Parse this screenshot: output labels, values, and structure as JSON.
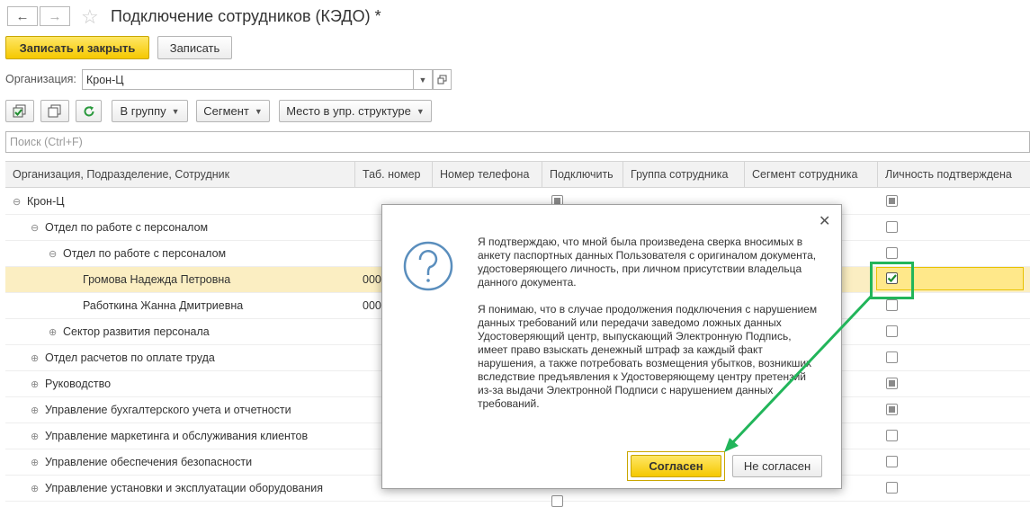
{
  "header": {
    "back_icon": "arrow-left-icon",
    "forward_icon": "arrow-right-icon",
    "favorite_icon": "star-icon",
    "title": "Подключение сотрудников (КЭДО) *"
  },
  "toolbar": {
    "save_close_label": "Записать и закрыть",
    "save_label": "Записать"
  },
  "organization": {
    "label": "Организация:",
    "value": "Крон-Ц"
  },
  "actions": {
    "group_label": "В группу",
    "segment_label": "Сегмент",
    "place_label": "Место в упр. структуре"
  },
  "search": {
    "placeholder": "Поиск (Ctrl+F)"
  },
  "table": {
    "columns": [
      "Организация, Подразделение, Сотрудник",
      "Таб. номер",
      "Номер телефона",
      "Подключить",
      "Группа сотрудника",
      "Сегмент сотрудника",
      "Личность подтверждена"
    ],
    "rows": [
      {
        "name": "Крон-Ц",
        "tab": "",
        "connect": "gray",
        "confirmed": "gray"
      },
      {
        "name": "Отдел по работе с персоналом",
        "tab": "",
        "connect": "",
        "confirmed": "empty"
      },
      {
        "name": "Отдел по работе с персоналом",
        "tab": "",
        "connect": "",
        "confirmed": "empty"
      },
      {
        "name": "Громова Надежда Петровна",
        "tab": "000",
        "connect": "",
        "confirmed": "checked"
      },
      {
        "name": "Работкина Жанна Дмитриевна",
        "tab": "000",
        "connect": "",
        "confirmed": "empty"
      },
      {
        "name": "Сектор развития персонала",
        "tab": "",
        "connect": "",
        "confirmed": "empty"
      },
      {
        "name": "Отдел расчетов по оплате труда",
        "tab": "",
        "connect": "",
        "confirmed": "empty"
      },
      {
        "name": "Руководство",
        "tab": "",
        "connect": "",
        "confirmed": "gray"
      },
      {
        "name": "Управление бухгалтерского учета и отчетности",
        "tab": "",
        "connect": "",
        "confirmed": "gray"
      },
      {
        "name": "Управление маркетинга и обслуживания клиентов",
        "tab": "",
        "connect": "",
        "confirmed": "empty"
      },
      {
        "name": "Управление обеспечения безопасности",
        "tab": "",
        "connect": "",
        "confirmed": "empty"
      },
      {
        "name": "Управление установки и эксплуатации оборудования",
        "tab": "",
        "connect": "empty",
        "confirmed": "empty"
      }
    ]
  },
  "dialog": {
    "paragraph1": "Я подтверждаю, что мной была произведена сверка вносимых в анкету паспортных данных Пользователя с оригиналом документа, удостоверяющего личность, при личном присутствии владельца данного документа.",
    "paragraph2": "Я понимаю, что в случае продолжения подключения с нарушением данных требований или передачи заведомо ложных данных Удостоверяющий центр, выпускающий Электронную Подпись, имеет право взыскать денежный штраф за каждый факт нарушения, а также потребовать возмещения убытков, возникших вследствие предъявления к Удостоверяющему центру претензий из-за выдачи Электронной Подписи с нарушением данных требований.",
    "agree_label": "Согласен",
    "disagree_label": "Не согласен",
    "close_icon": "close-icon",
    "question_icon": "question-circle-icon"
  },
  "colors": {
    "accent_yellow": "#f5c800",
    "highlight_green": "#22b55a",
    "selected_row": "#fbeec2",
    "dialog_icon": "#5a8ebd"
  }
}
